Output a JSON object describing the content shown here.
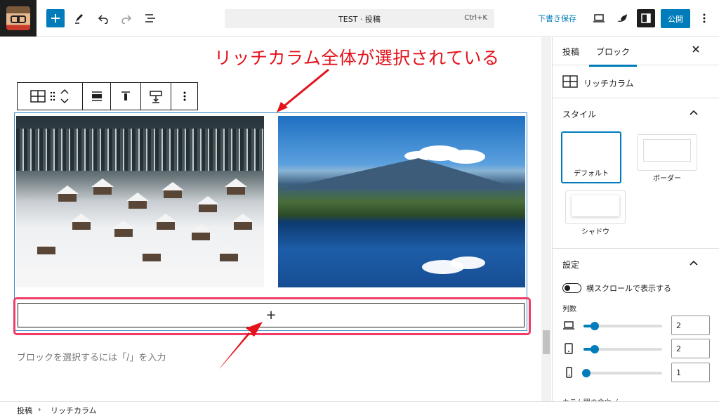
{
  "header": {
    "doc_title": "TEST · 投稿",
    "shortcut": "Ctrl+K",
    "save_draft": "下書き保存",
    "publish": "公開"
  },
  "canvas": {
    "annotation": "リッチカラム全体が選択されている",
    "appender_symbol": "+",
    "placeholder": "ブロックを選択するには「/」を入力"
  },
  "sidebar": {
    "tabs": [
      "投稿",
      "ブロック"
    ],
    "active_tab": "ブロック",
    "block_name": "リッチカラム",
    "styles_heading": "スタイル",
    "styles": [
      "デフォルト",
      "ボーダー",
      "シャドウ"
    ],
    "selected_style": "デフォルト",
    "settings_heading": "設定",
    "horizontal_scroll_label": "横スクロールで表示する",
    "columns_label": "列数",
    "columns": {
      "desktop": "2",
      "tablet": "2",
      "mobile": "1"
    },
    "truncated_label": "カラム間の余白（"
  },
  "breadcrumb": [
    "投稿",
    "リッチカラム"
  ],
  "colors": {
    "accent": "#007cba",
    "annotation": "#e3121b",
    "highlight": "#ef3d6a"
  }
}
